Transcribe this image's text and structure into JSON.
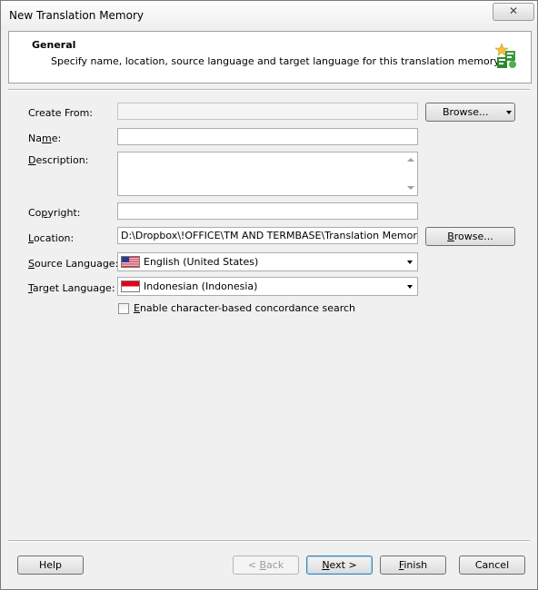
{
  "window": {
    "title": "New Translation Memory",
    "close_label": "✕"
  },
  "header": {
    "title": "General",
    "description": "Specify name, location, source language and target language for this translation memory.",
    "icon": "translation-memory-wizard-icon"
  },
  "form": {
    "create_from": {
      "label_pre": "Create From:",
      "value": "",
      "browse_label": "Browse..."
    },
    "name": {
      "label_a": "Na",
      "label_u": "m",
      "label_b": "e:",
      "value": ""
    },
    "description": {
      "label_u": "D",
      "label_b": "escription:",
      "value": ""
    },
    "copyright": {
      "label_a": "Co",
      "label_u": "p",
      "label_b": "yright:",
      "value": ""
    },
    "location": {
      "label_u": "L",
      "label_b": "ocation:",
      "value": "D:\\Dropbox\\!OFFICE\\TM AND TERMBASE\\Translation Memory",
      "browse_label_u": "B",
      "browse_label_b": "rowse..."
    },
    "source_language": {
      "label_u": "S",
      "label_b": "ource Language:",
      "value": "English (United States)",
      "flag": "us-flag-icon"
    },
    "target_language": {
      "label_u": "T",
      "label_b": "arget Language:",
      "value": "Indonesian (Indonesia)",
      "flag": "indonesia-flag-icon"
    },
    "concordance": {
      "label_u": "E",
      "label_b": "nable character-based concordance search",
      "checked": false
    }
  },
  "footer": {
    "help": "Help",
    "back_a": "< ",
    "back_u": "B",
    "back_b": "ack",
    "next_u": "N",
    "next_b": "ext >",
    "finish_u": "F",
    "finish_b": "inish",
    "cancel": "Cancel"
  }
}
